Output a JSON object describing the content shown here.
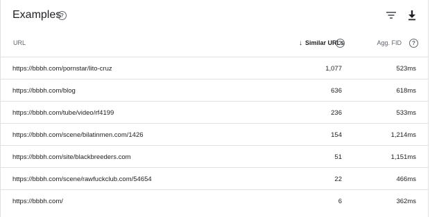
{
  "header": {
    "title": "Examples",
    "help_icon": "help-circle-icon",
    "filter_icon": "filter-icon",
    "download_icon": "download-icon"
  },
  "table": {
    "columns": {
      "url": "URL",
      "similar": "Similar URLs",
      "fid": "Agg. FID"
    },
    "sort": {
      "column": "similar",
      "direction": "descending",
      "icon": "arrow-down-icon"
    },
    "rows": [
      {
        "url": "https://bbbh.com/pornstar/lito-cruz",
        "similar": "1,077",
        "fid": "523ms"
      },
      {
        "url": "https://bbbh.com/blog",
        "similar": "636",
        "fid": "618ms"
      },
      {
        "url": "https://bbbh.com/tube/video/rf4199",
        "similar": "236",
        "fid": "533ms"
      },
      {
        "url": "https://bbbh.com/scene/bilatinmen.com/1426",
        "similar": "154",
        "fid": "1,214ms"
      },
      {
        "url": "https://bbbh.com/site/blackbreeders.com",
        "similar": "51",
        "fid": "1,151ms"
      },
      {
        "url": "https://bbbh.com/scene/rawfuckclub.com/54654",
        "similar": "22",
        "fid": "466ms"
      },
      {
        "url": "https://bbbh.com/",
        "similar": "6",
        "fid": "362ms"
      }
    ]
  },
  "colors": {
    "text": "#202124",
    "muted": "#5f6368",
    "divider": "#e0e0e0"
  }
}
